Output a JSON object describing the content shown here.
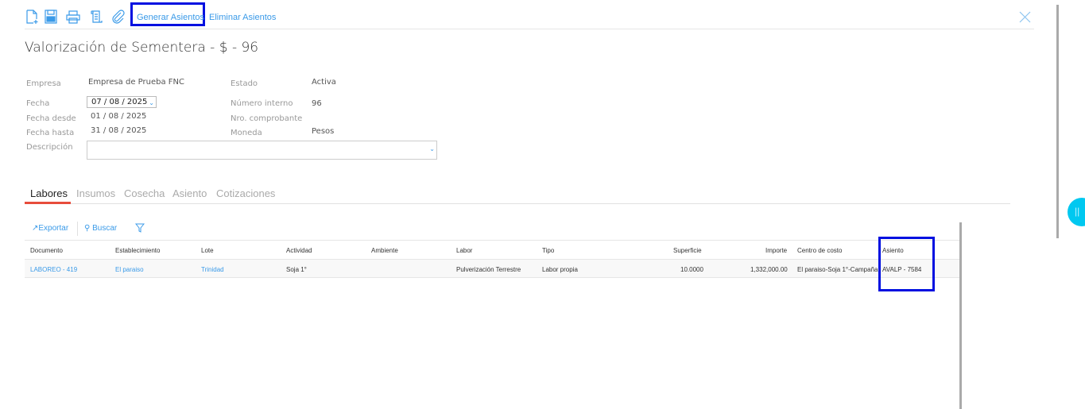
{
  "toolbar": {
    "icons": [
      "new-document-icon",
      "save-icon",
      "print-icon",
      "scroll-icon",
      "attach-icon"
    ],
    "generate": "Generar Asientos",
    "delete": "Eliminar Asientos"
  },
  "title": "Valorización de Sementera - $ - 96",
  "form": {
    "empresa_label": "Empresa",
    "empresa": "Empresa de Prueba FNC",
    "estado_label": "Estado",
    "estado": "Activa",
    "fecha_label": "Fecha",
    "fecha": "07 / 08 / 2025",
    "numero_label": "Número interno",
    "numero": "96",
    "desde_label": "Fecha desde",
    "desde": "01 / 08 / 2025",
    "comprobante_label": "Nro. comprobante",
    "hasta_label": "Fecha hasta",
    "hasta": "31 / 08 / 2025",
    "moneda_label": "Moneda",
    "moneda": "Pesos",
    "descripcion_label": "Descripción",
    "descripcion": ""
  },
  "tabs": [
    "Labores",
    "Insumos",
    "Cosecha",
    "Asiento",
    "Cotizaciones"
  ],
  "grid_toolbar": {
    "export": "Exportar",
    "search": "Buscar"
  },
  "table": {
    "headers": [
      "Documento",
      "Establecimiento",
      "Lote",
      "Actividad",
      "Ambiente",
      "Labor",
      "Tipo",
      "Superficie",
      "Importe",
      "Centro de costo",
      "Asiento"
    ],
    "rows": [
      [
        "LABOREO - 419",
        "El paraiso",
        "Trinidad",
        "Soja 1°",
        "",
        "Pulverización Terrestre",
        "Labor propia",
        "10.0000",
        "1,332,000.00",
        "El paraiso-Soja 1°-Campaña",
        "AVALP - 7584"
      ]
    ]
  },
  "colors": {
    "accent": "#3a9ae8",
    "tab_active": "#e74c3c",
    "highlight": "#0010e0",
    "fab": "#00c8f0"
  }
}
